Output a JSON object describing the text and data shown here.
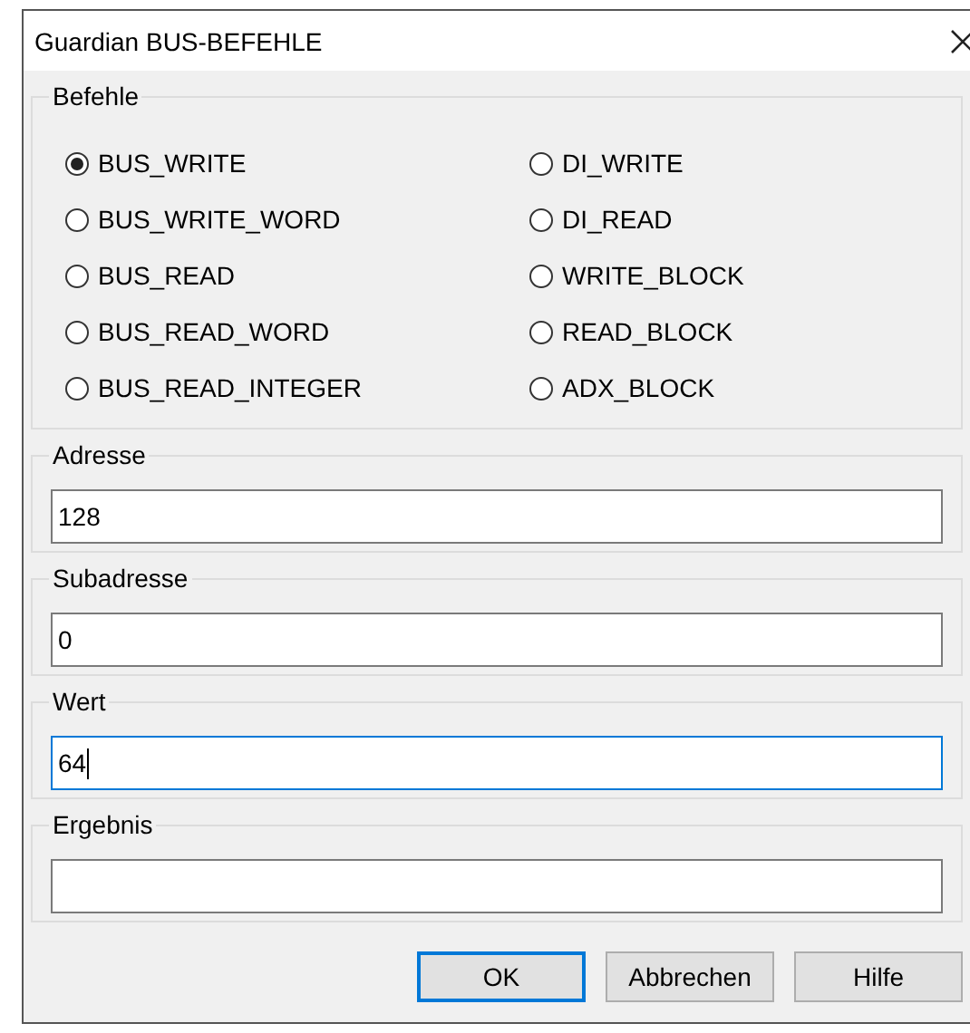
{
  "window": {
    "title": "Guardian BUS-BEFEHLE"
  },
  "commands": {
    "title": "Befehle",
    "options": [
      {
        "label": "BUS_WRITE",
        "selected": true
      },
      {
        "label": "BUS_WRITE_WORD",
        "selected": false
      },
      {
        "label": "BUS_READ",
        "selected": false
      },
      {
        "label": "BUS_READ_WORD",
        "selected": false
      },
      {
        "label": "BUS_READ_INTEGER",
        "selected": false
      },
      {
        "label": "DI_WRITE",
        "selected": false
      },
      {
        "label": "DI_READ",
        "selected": false
      },
      {
        "label": "WRITE_BLOCK",
        "selected": false
      },
      {
        "label": "READ_BLOCK",
        "selected": false
      },
      {
        "label": "ADX_BLOCK",
        "selected": false
      }
    ]
  },
  "fields": [
    {
      "label": "Adresse",
      "value": "128",
      "focused": false
    },
    {
      "label": "Subadresse",
      "value": "0",
      "focused": false
    },
    {
      "label": "Wert",
      "value": "64",
      "focused": true
    },
    {
      "label": "Ergebnis",
      "focused": false
    }
  ],
  "buttons": [
    {
      "label": "OK",
      "default": true
    },
    {
      "label": "Abbrechen",
      "default": false
    },
    {
      "label": "Hilfe",
      "default": false
    }
  ]
}
